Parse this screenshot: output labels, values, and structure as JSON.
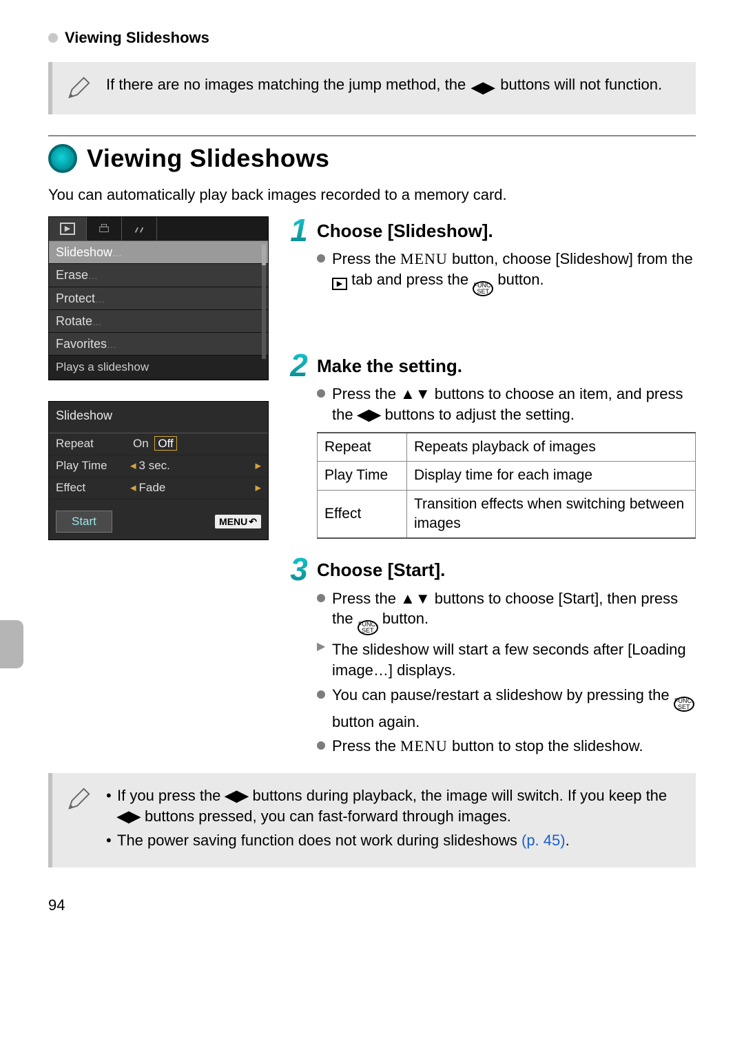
{
  "header": {
    "title": "Viewing Slideshows"
  },
  "note1": {
    "text_a": "If there are no images matching the jump method, the ",
    "text_b": " buttons will not function."
  },
  "section": {
    "title": "Viewing Slideshows",
    "intro": "You can automatically play back images recorded to a memory card."
  },
  "cam_menu": {
    "items": [
      "Slideshow",
      "Erase",
      "Protect",
      "Rotate",
      "Favorites"
    ],
    "desc": "Plays a slideshow"
  },
  "cam_settings": {
    "title": "Slideshow",
    "rows": {
      "repeat": {
        "label": "Repeat",
        "on": "On",
        "off": "Off"
      },
      "playtime": {
        "label": "Play Time",
        "value": "3 sec."
      },
      "effect": {
        "label": "Effect",
        "value": "Fade"
      }
    },
    "start": "Start",
    "menu_badge": "MENU"
  },
  "steps": {
    "s1": {
      "num": "1",
      "title": "Choose [Slideshow].",
      "b1a": "Press the ",
      "b1b": " button, choose [Slideshow] from the ",
      "b1c": " tab and press the ",
      "b1d": " button.",
      "menu_word": "MENU"
    },
    "s2": {
      "num": "2",
      "title": "Make the setting.",
      "b1a": "Press the ",
      "b1b": " buttons to choose an item, and press the ",
      "b1c": " buttons to adjust the setting.",
      "table": [
        {
          "k": "Repeat",
          "v": "Repeats playback of images"
        },
        {
          "k": "Play Time",
          "v": "Display time for each image"
        },
        {
          "k": "Effect",
          "v": "Transition effects when switching between images"
        }
      ]
    },
    "s3": {
      "num": "3",
      "title": "Choose [Start].",
      "b1a": "Press the ",
      "b1b": " buttons to choose [Start], then press the ",
      "b1c": " button.",
      "b2": "The slideshow will start a few seconds after [Loading image…] displays.",
      "b3a": "You can pause/restart a slideshow by pressing the ",
      "b3b": " button again.",
      "b4a": "Press the ",
      "b4b": " button to stop the slideshow.",
      "menu_word": "MENU"
    }
  },
  "note2": {
    "l1a": "If you press the ",
    "l1b": " buttons during playback, the image will switch. If you keep the ",
    "l1c": " buttons pressed, you can fast-forward through images.",
    "l2a": "The power saving function does not work during slideshows ",
    "l2b": "(p. 45)",
    "l2c": "."
  },
  "page_number": "94",
  "icons": {
    "lr": "◀▶",
    "ud": "▲▼",
    "play": "▶",
    "func_top": "FUNC.",
    "func_bot": "SET"
  }
}
